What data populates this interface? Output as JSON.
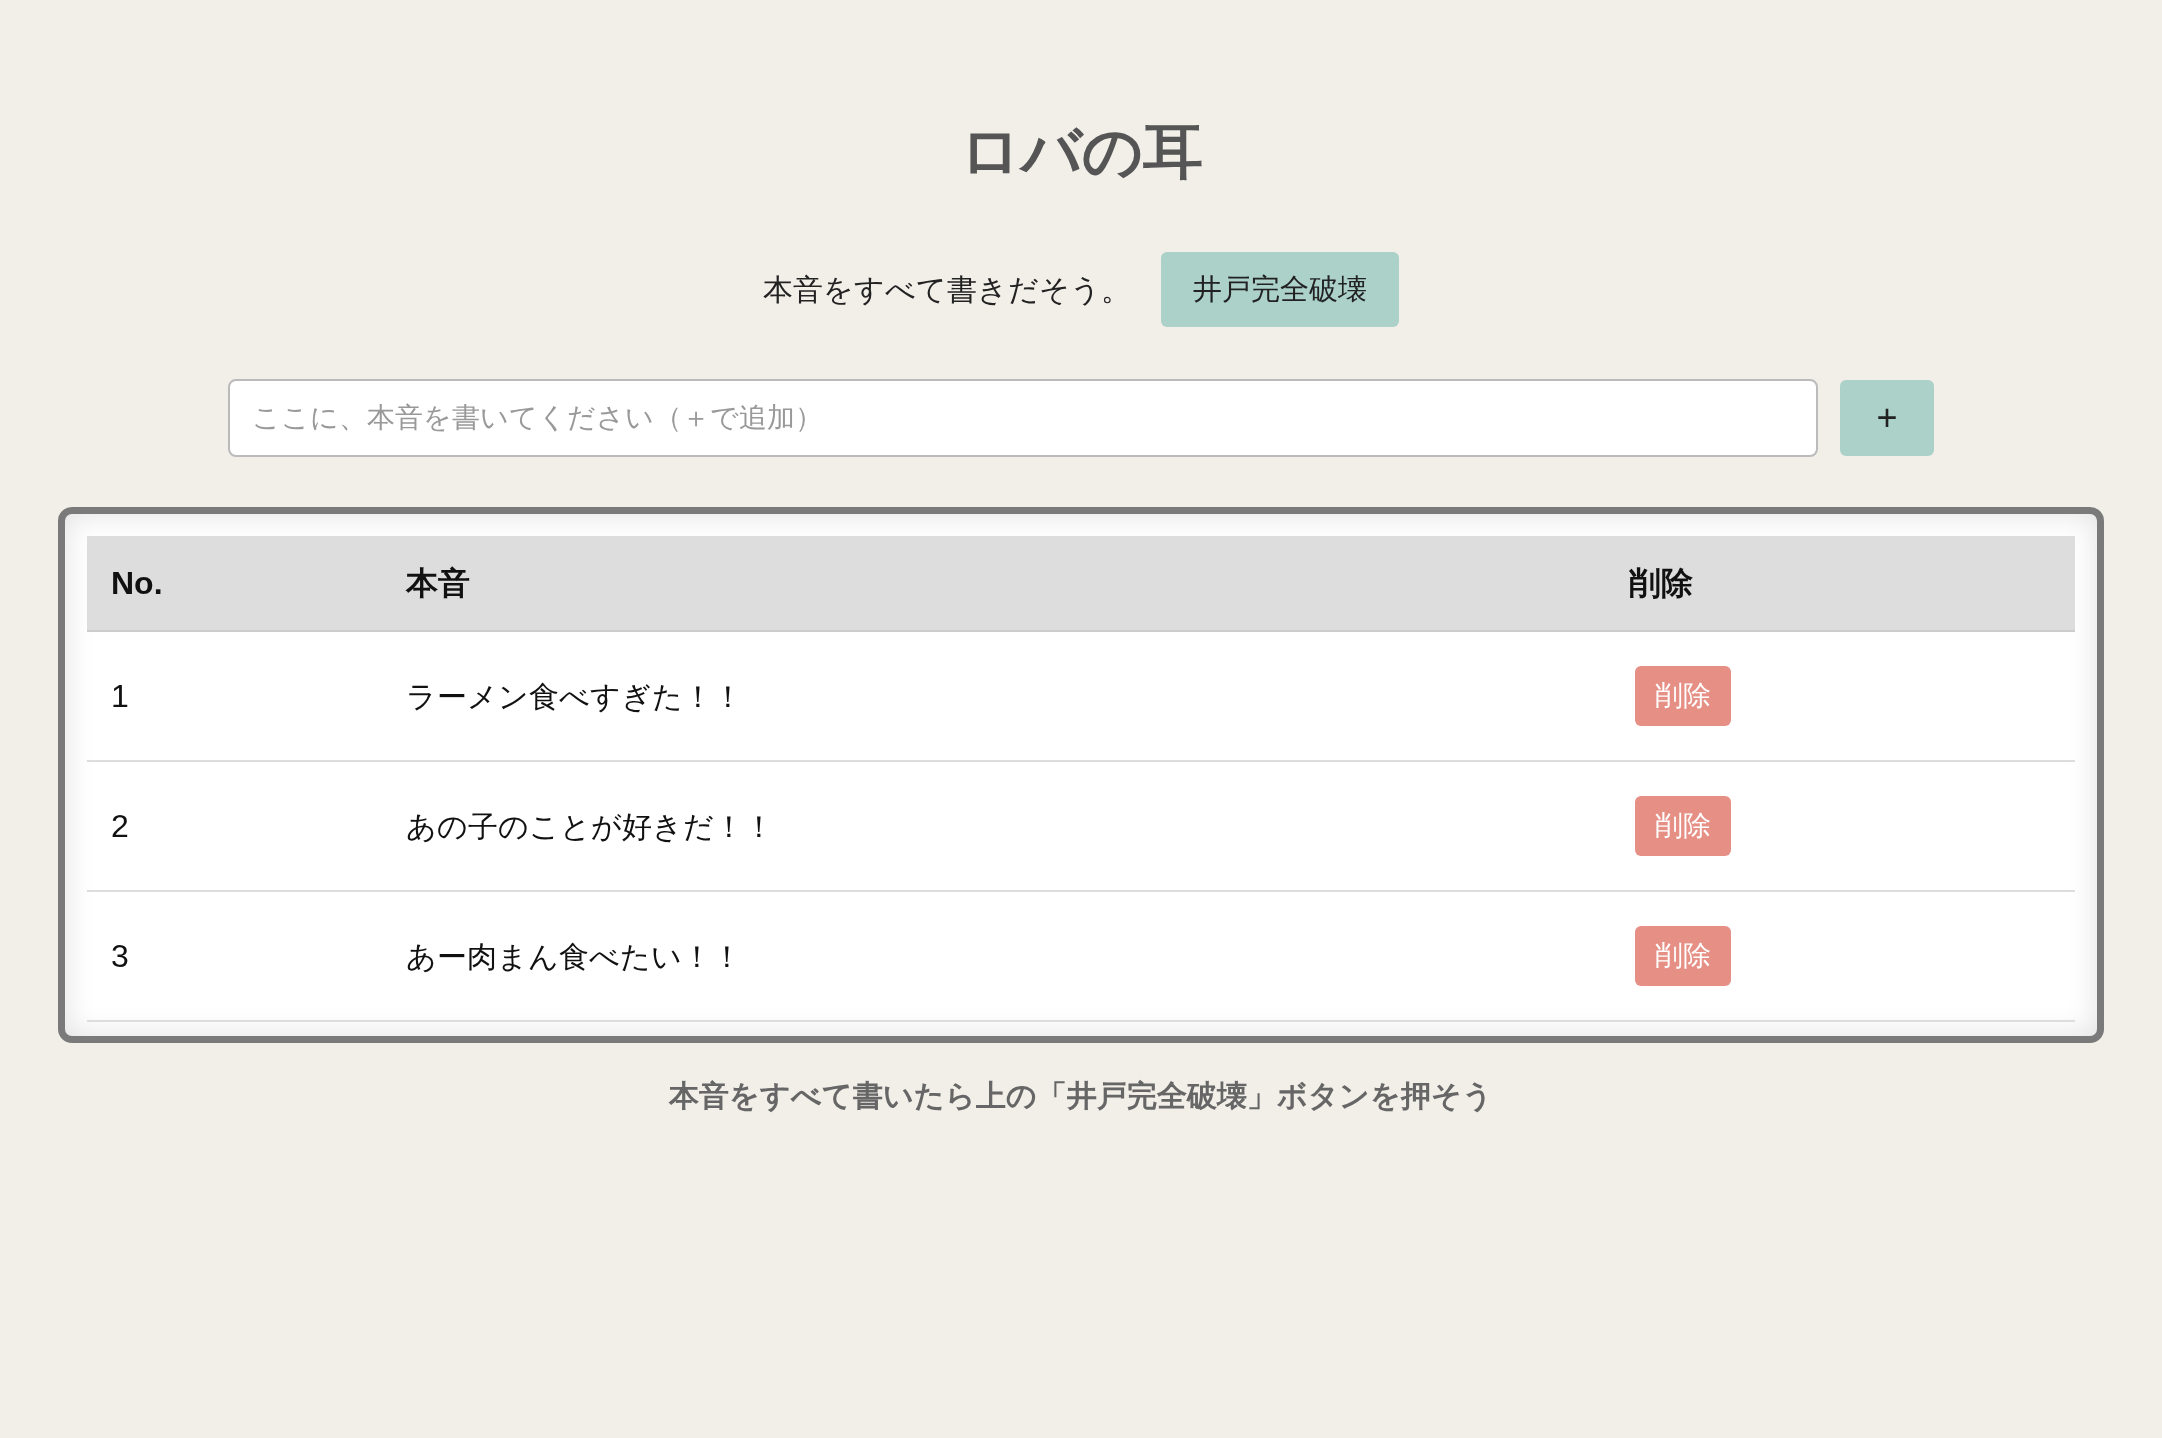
{
  "title": "ロバの耳",
  "intro": {
    "text": "本音をすべて書きだそう。",
    "button": "井戸完全破壊"
  },
  "input": {
    "placeholder": "ここに、本音を書いてください（＋で追加）",
    "add_button": "+"
  },
  "table": {
    "columns": [
      "No.",
      "本音",
      "削除"
    ],
    "rows": [
      {
        "no": "1",
        "text": "ラーメン食べすぎた！！",
        "delete": "削除"
      },
      {
        "no": "2",
        "text": "あの子のことが好きだ！！",
        "delete": "削除"
      },
      {
        "no": "3",
        "text": "あー肉まん食べたい！！",
        "delete": "削除"
      }
    ]
  },
  "footer": "本音をすべて書いたら上の「井戸完全破壊」ボタンを押そう"
}
